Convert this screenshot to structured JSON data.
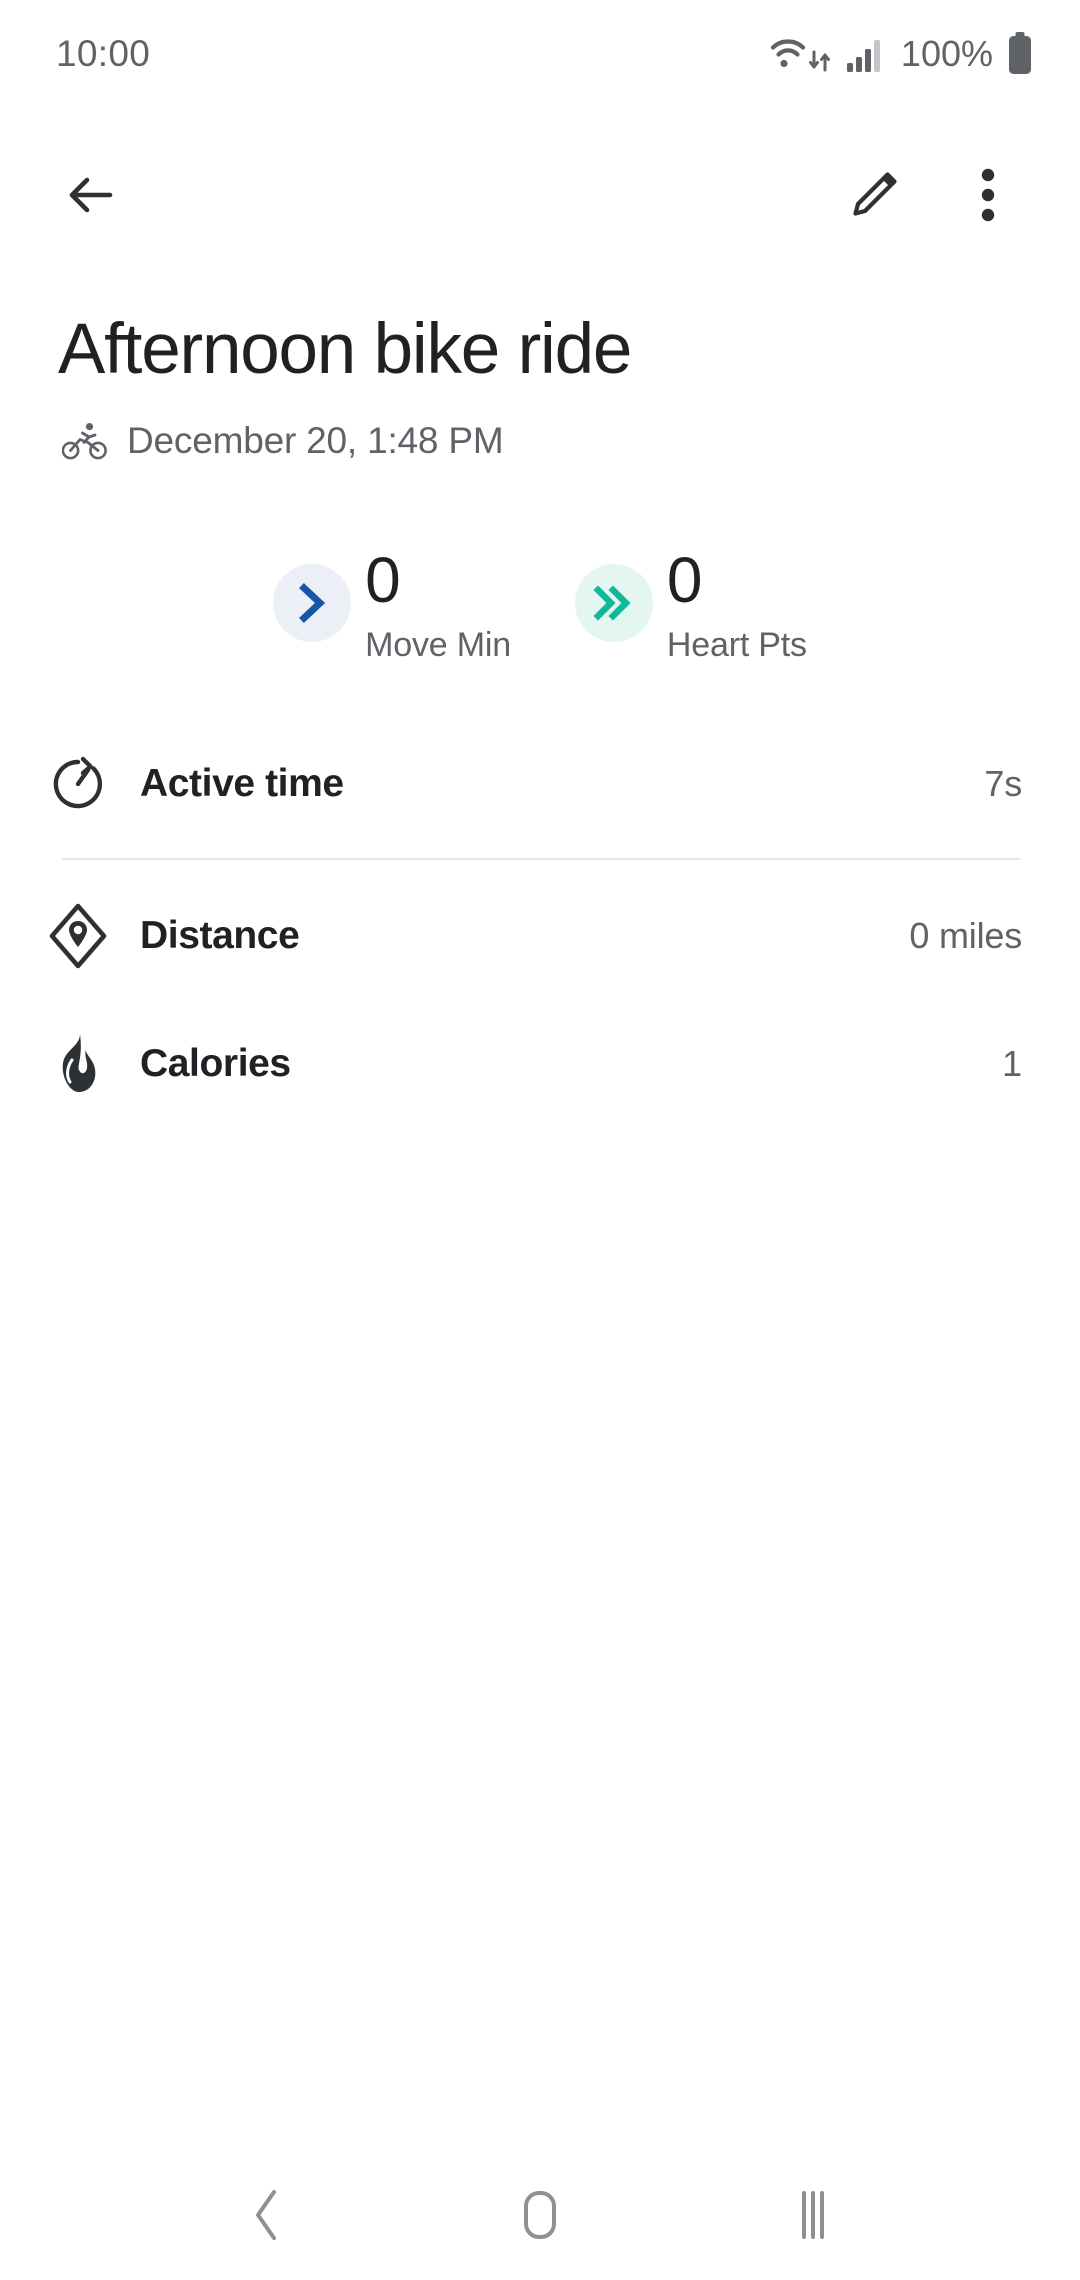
{
  "status_bar": {
    "clock": "10:00",
    "battery_percent": "100%",
    "icons": {
      "wifi": "wifi-icon",
      "data_transfer": "data-transfer-arrows-icon",
      "signal": "cellular-signal-icon",
      "battery": "battery-full-icon"
    }
  },
  "toolbar": {
    "back": "back-arrow-icon",
    "edit": "pencil-edit-icon",
    "overflow": "more-options-icon"
  },
  "header": {
    "title": "Afternoon bike ride",
    "activity_icon": "bike-icon",
    "datetime": "December 20, 1:48 PM"
  },
  "stats": [
    {
      "value": "0",
      "label": "Move Min",
      "icon": "single-chevron-right-icon",
      "icon_color": "#1a56a8",
      "badge_color": "#eceff5"
    },
    {
      "value": "0",
      "label": "Heart Pts",
      "icon": "double-chevron-right-icon",
      "icon_color": "#0eb899",
      "badge_color": "#e3f6f1"
    }
  ],
  "metrics": [
    {
      "label": "Active time",
      "value": "7s",
      "icon": "timer-icon"
    },
    {
      "label": "Distance",
      "value": "0 miles",
      "icon": "distance-diamond-pin-icon"
    },
    {
      "label": "Calories",
      "value": "1",
      "icon": "flame-icon"
    }
  ],
  "navbar": {
    "back": "nav-back-icon",
    "home": "nav-home-icon",
    "recents": "nav-recents-icon"
  },
  "colors": {
    "background": "#ffffff",
    "primary_text": "#202124",
    "secondary_text": "#5f6368",
    "divider": "#e4e6e8",
    "move_min_accent": "#1a56a8",
    "heart_pts_accent": "#0eb899"
  }
}
